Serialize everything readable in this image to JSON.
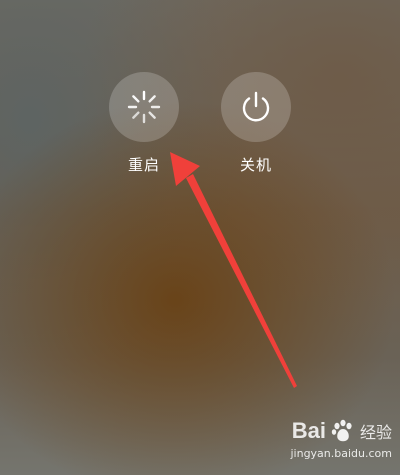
{
  "power_menu": {
    "reboot": {
      "label": "重启",
      "icon": "spinner-icon"
    },
    "shutdown": {
      "label": "关机",
      "icon": "power-icon"
    }
  },
  "annotation": {
    "arrow_color": "#f0403a"
  },
  "watermark": {
    "logo_text": "Bai",
    "logo_suffix": "经验",
    "url": "jingyan.baidu.com"
  }
}
